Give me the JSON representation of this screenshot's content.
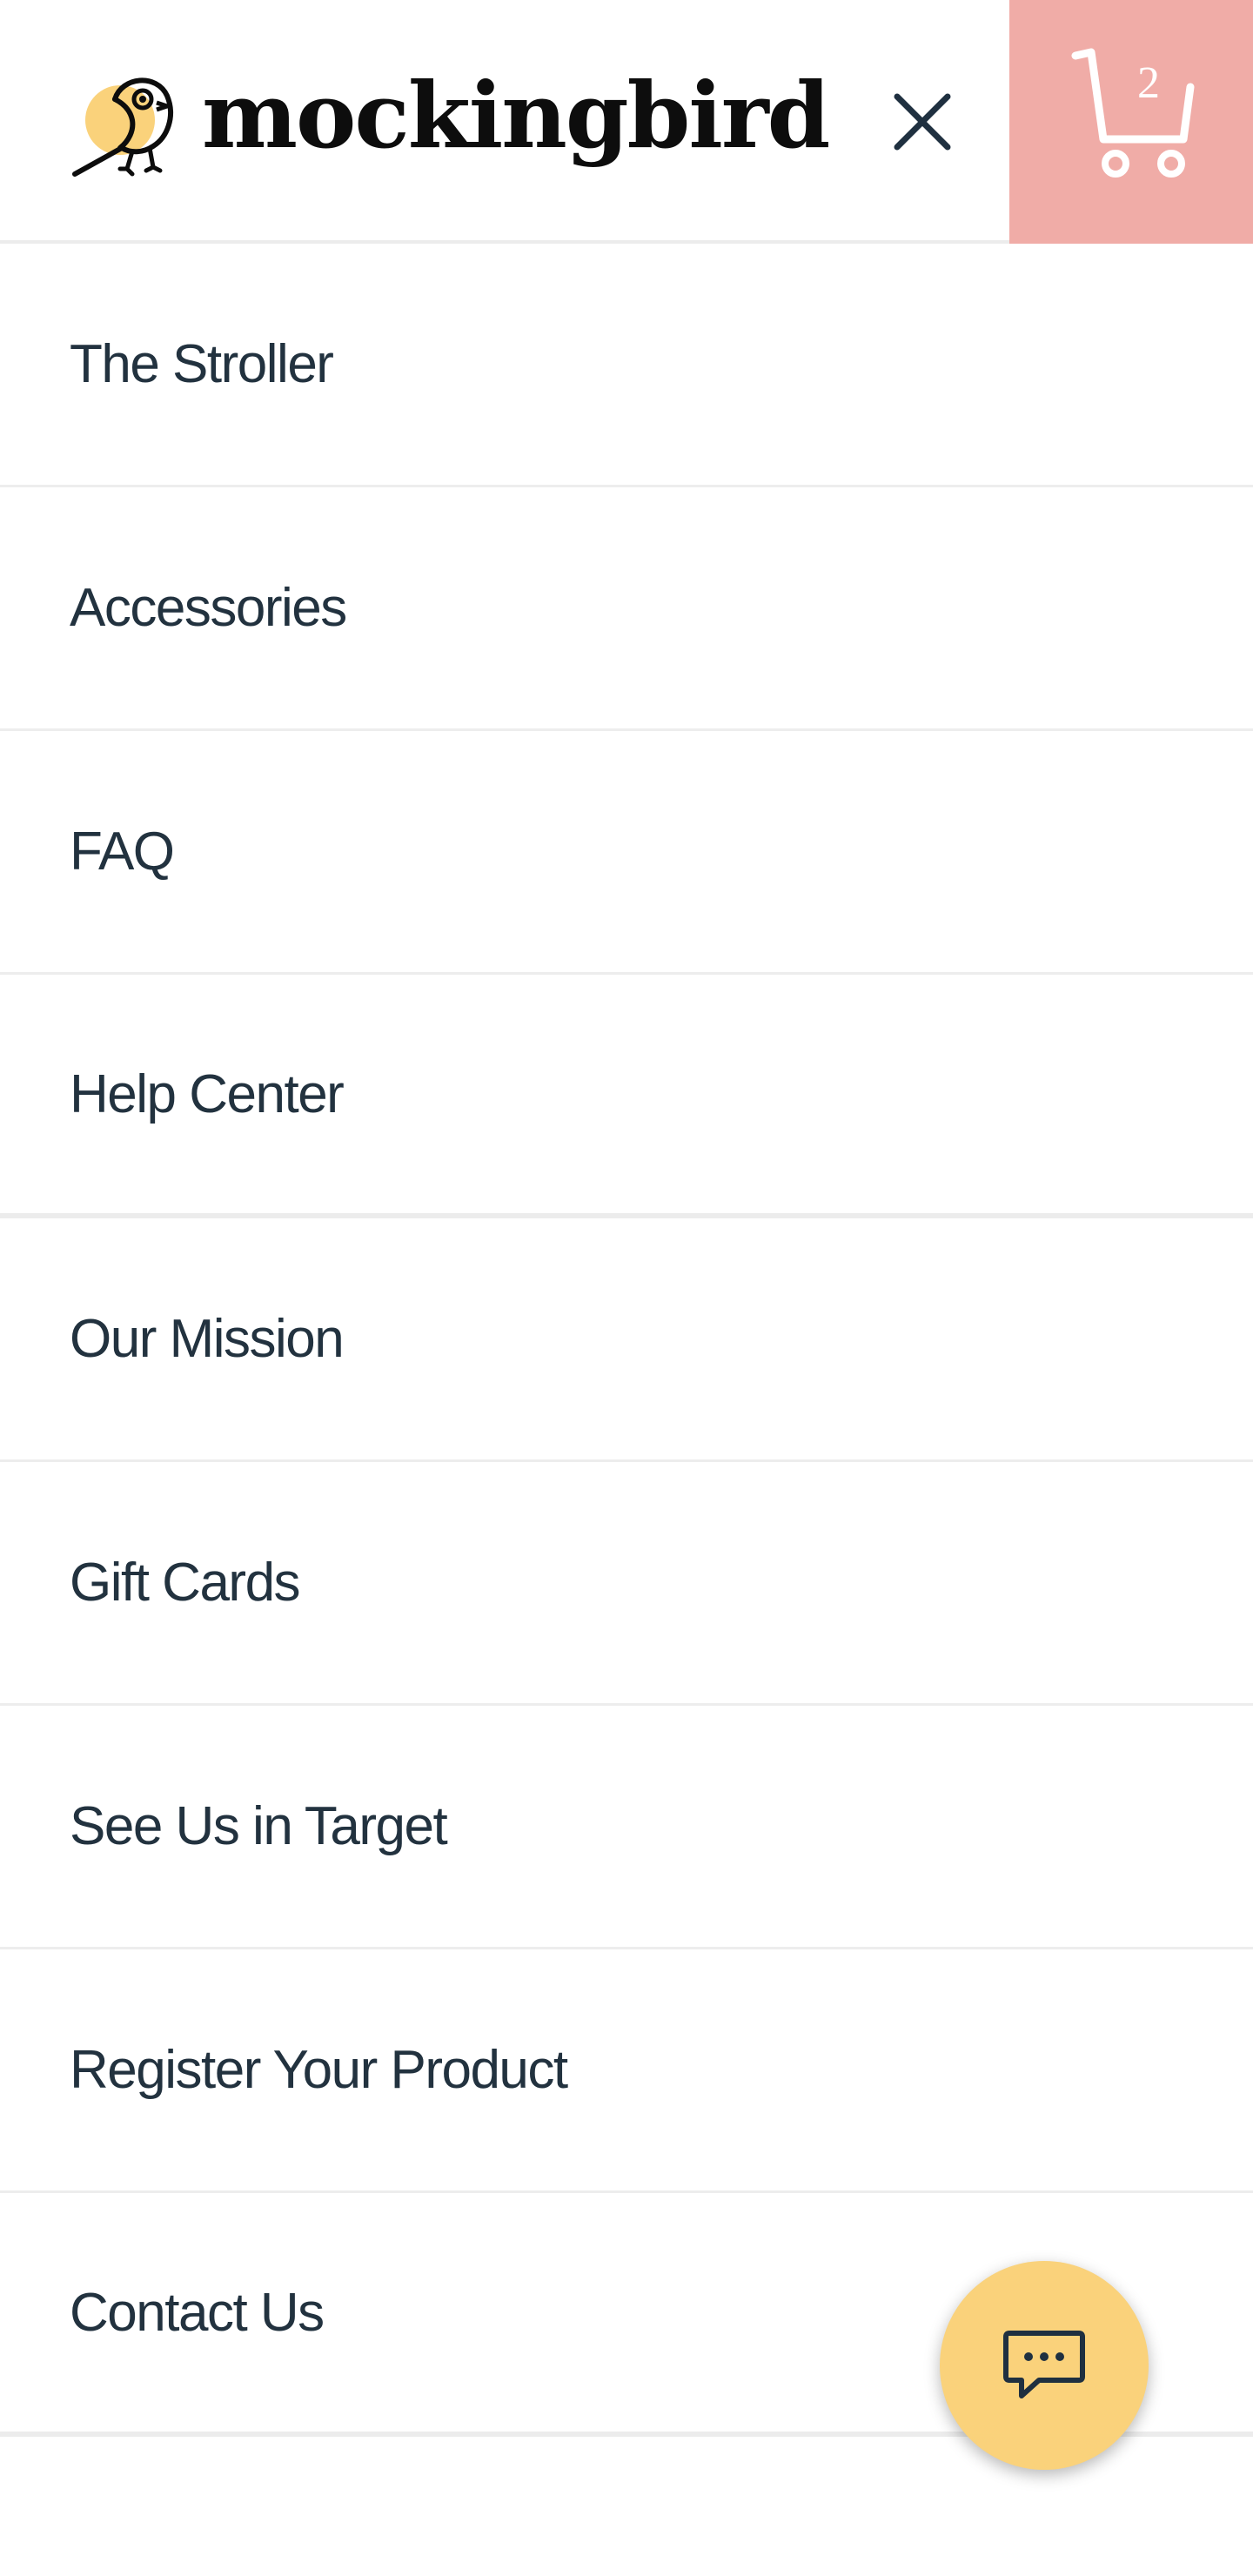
{
  "brand": {
    "name": "mockingbird",
    "accent_color": "#f0aca7",
    "fab_color": "#fad27b",
    "logo_icon": "bird-logo-icon"
  },
  "header": {
    "close_icon": "close-icon",
    "cart": {
      "icon": "cart-icon",
      "count": "2"
    }
  },
  "menu": {
    "items": [
      {
        "label": "The Stroller"
      },
      {
        "label": "Accessories"
      },
      {
        "label": "FAQ"
      },
      {
        "label": "Help Center"
      },
      {
        "label": "Our Mission"
      },
      {
        "label": "Gift Cards"
      },
      {
        "label": "See Us in Target"
      },
      {
        "label": "Register Your Product"
      },
      {
        "label": "Contact Us"
      }
    ]
  },
  "chat": {
    "icon": "chat-bubble-icon"
  }
}
